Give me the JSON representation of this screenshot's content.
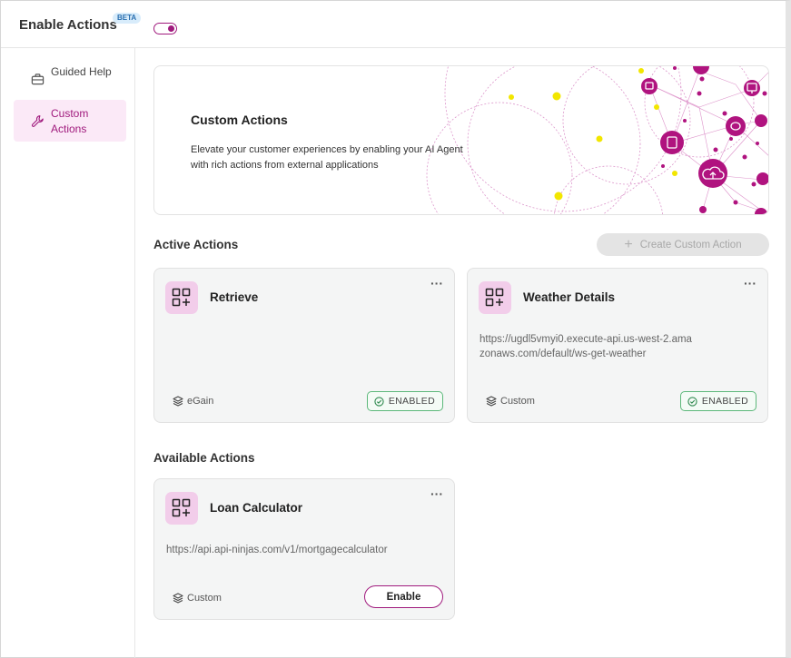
{
  "header": {
    "title": "Enable Actions",
    "badge": "BETA",
    "toggle_on": true
  },
  "sidebar": {
    "items": [
      {
        "label": "Guided Help",
        "icon": "briefcase-icon",
        "active": false
      },
      {
        "label": "Custom Actions",
        "icon": "wrench-icon",
        "active": true
      }
    ]
  },
  "hero": {
    "title": "Custom Actions",
    "description": "Elevate your customer experiences by enabling your AI Agent with rich actions from external applications"
  },
  "active_section": {
    "title": "Active Actions",
    "create_button": "Create Custom Action",
    "cards": [
      {
        "title": "Retrieve",
        "url": "",
        "source": "eGain",
        "status": "ENABLED"
      },
      {
        "title": "Weather Details",
        "url": "https://ugdl5vmyi0.execute-api.us-west-2.amazonaws.com/default/ws-get-weather",
        "source": "Custom",
        "status": "ENABLED"
      }
    ]
  },
  "available_section": {
    "title": "Available Actions",
    "cards": [
      {
        "title": "Loan Calculator",
        "url": "https://api.api-ninjas.com/v1/mortgagecalculator",
        "source": "Custom",
        "action": "Enable"
      }
    ]
  },
  "menu_glyph": "···",
  "colors": {
    "accent": "#a01a7d",
    "icon_bg": "#f2cdea",
    "enabled_border": "#5cb87a",
    "hero_yellow": "#f2e600"
  }
}
